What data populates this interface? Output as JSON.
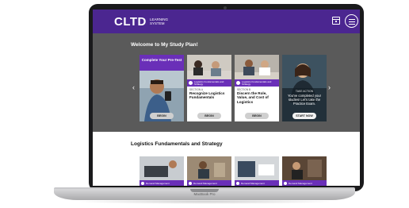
{
  "app": {
    "logo": "CLTD",
    "logo_subtitle": "LEARNING SYSTEM",
    "header_color": "#4b2690",
    "accent_color": "#6a2fb8"
  },
  "header": {
    "calendar_icon": "calendar-icon",
    "menu_icon": "hamburger-menu-icon"
  },
  "study_plan": {
    "title": "Welcome to My Study Plan!",
    "prev_arrow": "‹",
    "next_arrow": "›",
    "cards": [
      {
        "top_label": "Complete Your Pre-Test",
        "button": "BEGIN"
      },
      {
        "tag": "Logistics Fundamentals and Strategy",
        "section": "SECTION A",
        "title": "Recognize Logistics Fundamentals",
        "button": "BEGIN"
      },
      {
        "tag": "Logistics Fundamentals and Strategy",
        "section": "SECTION B",
        "title": "Discern the Role, Value, and Cost of Logistics",
        "button": "BEGIN"
      },
      {
        "label": "TAKE ACTION",
        "text": "You've completed your studies! Let's take the Practice Exam.",
        "button": "START NOW"
      }
    ]
  },
  "logistics": {
    "title": "Logistics Fundamentals and Strategy",
    "thumbs": [
      {
        "label": "Demand Management"
      },
      {
        "label": "Demand Management"
      },
      {
        "label": "Demand Management"
      },
      {
        "label": "Demand Management"
      }
    ]
  },
  "device": {
    "model": "MacBook Pro"
  }
}
